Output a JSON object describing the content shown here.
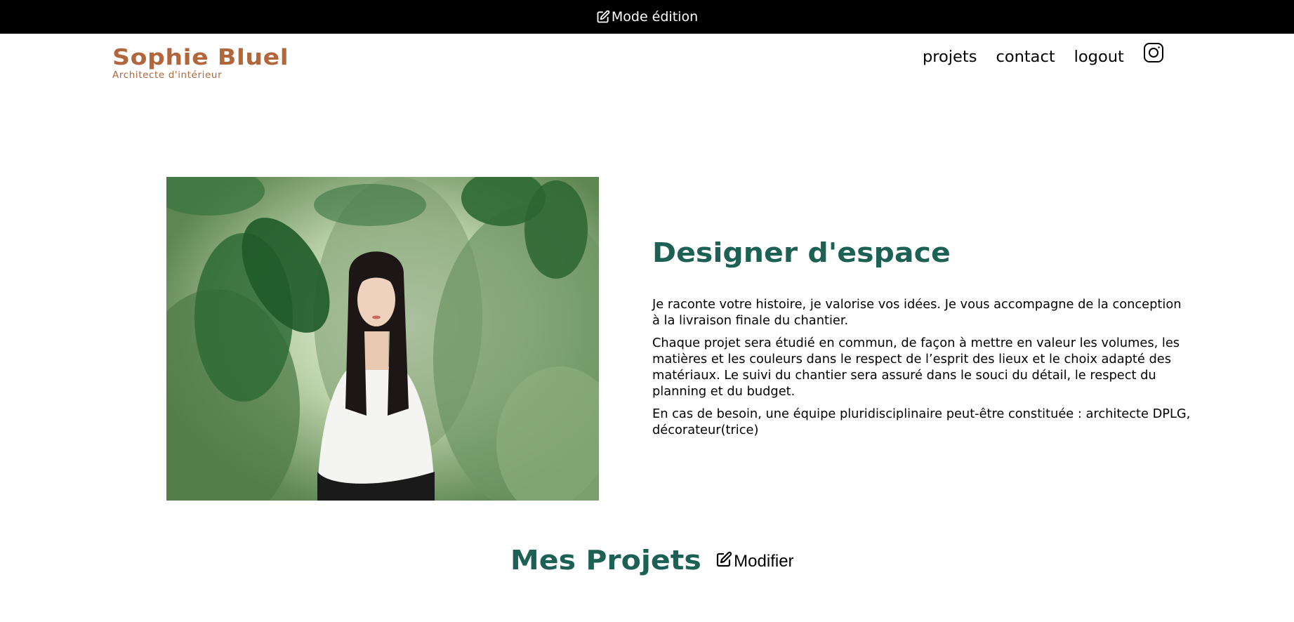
{
  "edit_bar": {
    "label": "Mode édition",
    "icon": "pen-to-square-icon"
  },
  "header": {
    "logo": {
      "title": "Sophie Bluel",
      "subtitle": "Architecte d'intérieur"
    },
    "nav": [
      {
        "label": "projets"
      },
      {
        "label": "contact"
      },
      {
        "label": "logout"
      }
    ],
    "social_icon": "instagram-icon"
  },
  "intro": {
    "title": "Designer d'espace",
    "paragraphs": [
      "Je raconte votre histoire, je valorise vos idées. Je vous accompagne de la conception à la livraison finale du chantier.",
      "Chaque projet sera étudié en commun, de façon à mettre en valeur les volumes, les matières et les couleurs dans le respect de l’esprit des lieux et le choix adapté des matériaux. Le suivi du chantier sera assuré dans le souci du détail, le respect du planning et du budget.",
      "En cas de besoin, une équipe pluridisciplinaire peut-être constituée : architecte DPLG, décorateur(trice)"
    ]
  },
  "projects": {
    "title": "Mes Projets",
    "modify_label": "Modifier",
    "modify_icon": "pen-to-square-icon"
  },
  "colors": {
    "brand": "#B1663C",
    "accent": "#1D6154",
    "edit_bar_bg": "#000000"
  }
}
